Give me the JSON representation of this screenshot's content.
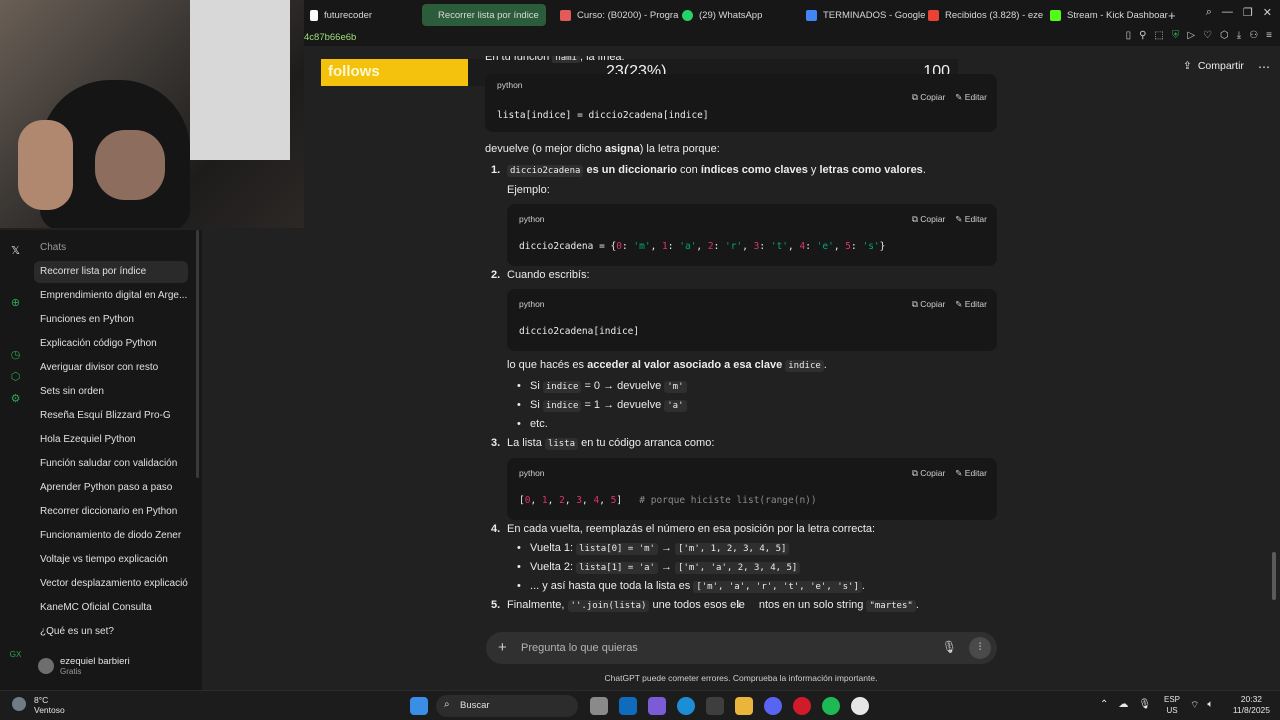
{
  "browser": {
    "tabs": [
      {
        "label": "futurecoder",
        "color": "#ffffff"
      },
      {
        "label": "Recorrer lista por índice",
        "color": "#9be37a",
        "active": true
      },
      {
        "label": "Curso: (B0200) - Progra",
        "color": "#e25a5a"
      },
      {
        "label": "(29) WhatsApp",
        "color": "#25d366"
      },
      {
        "label": "TERMINADOS - Google",
        "color": "#4285f4"
      },
      {
        "label": "Recibidos (3.828) - eze",
        "color": "#ea4335"
      },
      {
        "label": "Stream - Kick Dashboar",
        "color": "#53fc18"
      }
    ],
    "address_fragment": "4c87b66e6b"
  },
  "overlay": {
    "label": "follows",
    "progress_text": "23(23%)",
    "progress_fraction": 0.23,
    "goal": "100"
  },
  "header": {
    "share_label": "Compartir",
    "more_icon": "more-icon"
  },
  "sidebar": {
    "heading": "Chats",
    "items": [
      "Recorrer lista por índice",
      "Emprendimiento digital en Arge...",
      "Funciones en Python",
      "Explicación código Python",
      "Averiguar divisor con resto",
      "Sets sin orden",
      "Reseña Esquí Blizzard Pro-G",
      "Hola Ezequiel Python",
      "Función saludar con validación",
      "Aprender Python paso a paso",
      "Recorrer diccionario en Python",
      "Funcionamiento de diodo Zener",
      "Voltaje vs tiempo explicación",
      "Vector desplazamiento explicación",
      "KaneMC Oficial Consulta",
      "¿Qué es un set?"
    ],
    "user_name": "ezequiel barbieri",
    "user_plan": "Gratis",
    "gx_label": "GX"
  },
  "content": {
    "top_partial": "En tu función",
    "top_partial_code": "nami",
    "top_partial_rest": ", la línea:",
    "copy_label": "Copiar",
    "edit_label": "Editar",
    "lang": "python",
    "code1": "lista[indice] = diccio2cadena[indice]",
    "p1_a": "devuelve (o mejor dicho ",
    "p1_b": "asigna",
    "p1_c": ") la letra porque:",
    "item1_num": "1.",
    "item1_code": "diccio2cadena",
    "item1_b1": " es un diccionario",
    "item1_t1": " con ",
    "item1_b2": "índices como claves",
    "item1_t2": " y ",
    "item1_b3": "letras como valores",
    "item1_t3": ".",
    "ejemplo": "Ejemplo:",
    "code2_prefix": "diccio2cadena = {",
    "code2_pairs": [
      {
        "k": "0",
        "v": "'m'"
      },
      {
        "k": "1",
        "v": "'a'"
      },
      {
        "k": "2",
        "v": "'r'"
      },
      {
        "k": "3",
        "v": "'t'"
      },
      {
        "k": "4",
        "v": "'e'"
      },
      {
        "k": "5",
        "v": "'s'"
      }
    ],
    "item2_num": "2.",
    "item2": "Cuando escribís:",
    "code3": "diccio2cadena[indice]",
    "p2_a": "lo que hacés es ",
    "p2_b": "acceder al valor asociado a esa clave",
    "p2_code": "indice",
    "p2_c": ".",
    "bullet1_a": "Si",
    "bullet1_code": "indice",
    "bullet1_b": "= 0 → devuelve",
    "bullet1_code2": "'m'",
    "bullet2_a": "Si",
    "bullet2_code": "indice",
    "bullet2_b": "= 1 → devuelve",
    "bullet2_code2": "'a'",
    "bullet3": "etc.",
    "item3_num": "3.",
    "item3_a": "La lista",
    "item3_code": "lista",
    "item3_b": "en tu código arranca como:",
    "code4_nums": [
      "0",
      "1",
      "2",
      "3",
      "4",
      "5"
    ],
    "code4_comment": "# porque hiciste list(range(n))",
    "item4_num": "4.",
    "item4": "En cada vuelta, reemplazás el número en esa posición por la letra correcta:",
    "v1_label": "Vuelta 1:",
    "v1_code": "lista[0] = 'm'",
    "v1_result": "['m', 1, 2, 3, 4, 5]",
    "v2_label": "Vuelta 2:",
    "v2_code": "lista[1] = 'a'",
    "v2_result": "['m', 'a', 2, 3, 4, 5]",
    "v3_a": "... y así hasta que toda la lista es",
    "v3_code": "['m', 'a', 'r', 't', 'e', 's']",
    "v3_b": ".",
    "item5_num": "5.",
    "item5_a": "Finalmente,",
    "item5_code": "''.join(lista)",
    "item5_b": "une todos esos ele",
    "item5_c": "ntos en un solo string",
    "item5_code2": "\"martes\"",
    "item5_d": "."
  },
  "composer": {
    "placeholder": "Pregunta lo que quieras",
    "disclaimer": "ChatGPT puede cometer errores. Comprueba la información importante."
  },
  "taskbar": {
    "temp": "8°C",
    "weather": "Ventoso",
    "search_label": "Buscar",
    "lang_top": "ESP",
    "lang_bottom": "US",
    "time": "20:32",
    "date": "11/8/2025"
  }
}
